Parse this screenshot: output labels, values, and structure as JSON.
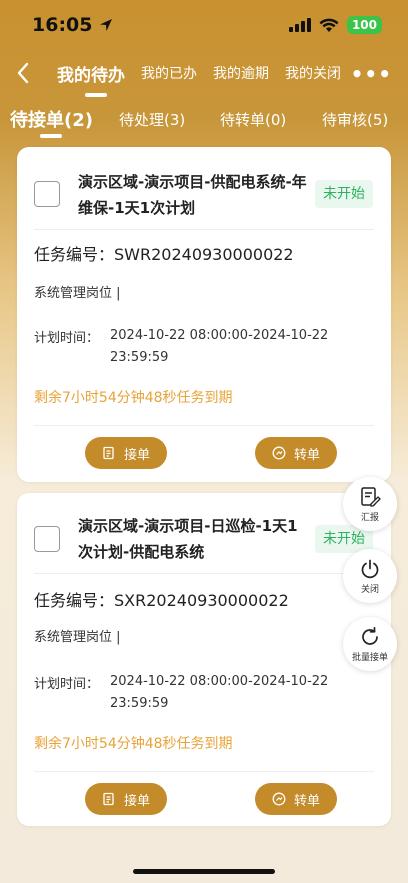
{
  "status_bar": {
    "time": "16:05",
    "battery": "100"
  },
  "nav": {
    "tabs": [
      {
        "label": "我的待办",
        "active": true
      },
      {
        "label": "我的已办",
        "active": false
      },
      {
        "label": "我的逾期",
        "active": false
      },
      {
        "label": "我的关闭",
        "active": false
      }
    ]
  },
  "sub_tabs": [
    {
      "label": "待接单(2)",
      "active": true
    },
    {
      "label": "待处理(3)",
      "active": false
    },
    {
      "label": "待转单(0)",
      "active": false
    },
    {
      "label": "待审核(5)",
      "active": false
    }
  ],
  "cards": [
    {
      "title": "演示区域-演示项目-供配电系统-年维保-1天1次计划",
      "status": "未开始",
      "task_no": "任务编号：SWR20240930000022",
      "post": "系统管理岗位 |",
      "plan_label": "计划时间：",
      "plan_value": "2024-10-22 08:00:00-2024-10-22 23:59:59",
      "remain": "剩余7小时54分钟48秒任务到期",
      "accept_label": "接单",
      "transfer_label": "转单"
    },
    {
      "title": "演示区域-演示项目-日巡检-1天1次计划-供配电系统",
      "status": "未开始",
      "task_no": "任务编号：SXR20240930000022",
      "post": "系统管理岗位 |",
      "plan_label": "计划时间：",
      "plan_value": "2024-10-22 08:00:00-2024-10-22 23:59:59",
      "remain": "剩余7小时54分钟48秒任务到期",
      "accept_label": "接单",
      "transfer_label": "转单"
    }
  ],
  "fabs": {
    "report_label": "汇报",
    "close_label": "关闭",
    "batch_label": "批量接单"
  },
  "colors": {
    "accent": "#c48b2a",
    "status_green": "#2bb160",
    "warning_orange": "#e8a338"
  }
}
